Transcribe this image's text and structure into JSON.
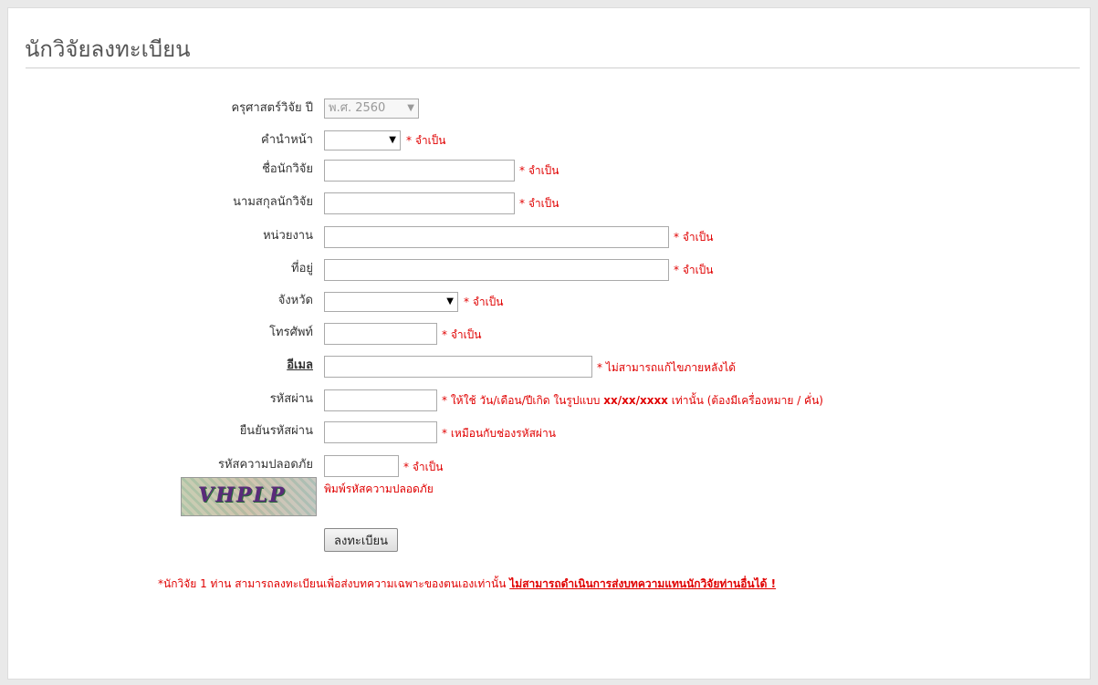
{
  "page": {
    "title": "นักวิจัยลงทะเบียน"
  },
  "form": {
    "year": {
      "label": "ครุศาสตร์วิจัย ปี",
      "value": "พ.ศ. 2560"
    },
    "prefix": {
      "label": "คำนำหน้า",
      "value": "",
      "req": "* จำเป็น"
    },
    "firstname": {
      "label": "ชื่อนักวิจัย",
      "value": "",
      "req": "* จำเป็น"
    },
    "lastname": {
      "label": "นามสกุลนักวิจัย",
      "value": "",
      "req": "* จำเป็น"
    },
    "unit": {
      "label": "หน่วยงาน",
      "value": "",
      "req": "* จำเป็น"
    },
    "address": {
      "label": "ที่อยู่",
      "value": "",
      "req": "* จำเป็น"
    },
    "province": {
      "label": "จังหวัด",
      "value": "",
      "req": "* จำเป็น"
    },
    "phone": {
      "label": "โทรศัพท์",
      "value": "",
      "req": "* จำเป็น"
    },
    "email": {
      "label": "อีเมล",
      "value": "",
      "req": "* ไม่สามารถแก้ไขภายหลังได้"
    },
    "password": {
      "label": "รหัสผ่าน",
      "value": "",
      "req_pre": "* ให้ใช้ วัน/เดือน/ปีเกิด ในรูปแบบ ",
      "req_format": "xx/xx/xxxx",
      "req_post": " เท่านั้น (ต้องมีเครื่องหมาย / คั่น)"
    },
    "confirm": {
      "label": "ยืนยันรหัสผ่าน",
      "value": "",
      "req": "* เหมือนกับช่องรหัสผ่าน"
    },
    "captcha": {
      "label": "รหัสความปลอดภัย",
      "value": "",
      "req": "* จำเป็น",
      "image_text": "VHPLP",
      "hint": "พิมพ์รหัสความปลอดภัย"
    },
    "submit_label": "ลงทะเบียน"
  },
  "notice": {
    "text": "*นักวิจัย 1 ท่าน สามารถลงทะเบียนเพื่อส่งบทความเฉพาะของตนเองเท่านั้น ",
    "strong": "ไม่สามารถดำเนินการส่งบทความแทนนักวิจัยท่านอื่นได้ !"
  },
  "colors": {
    "required": "#e00000",
    "background": "#e9e9e9",
    "panel": "#ffffff"
  }
}
